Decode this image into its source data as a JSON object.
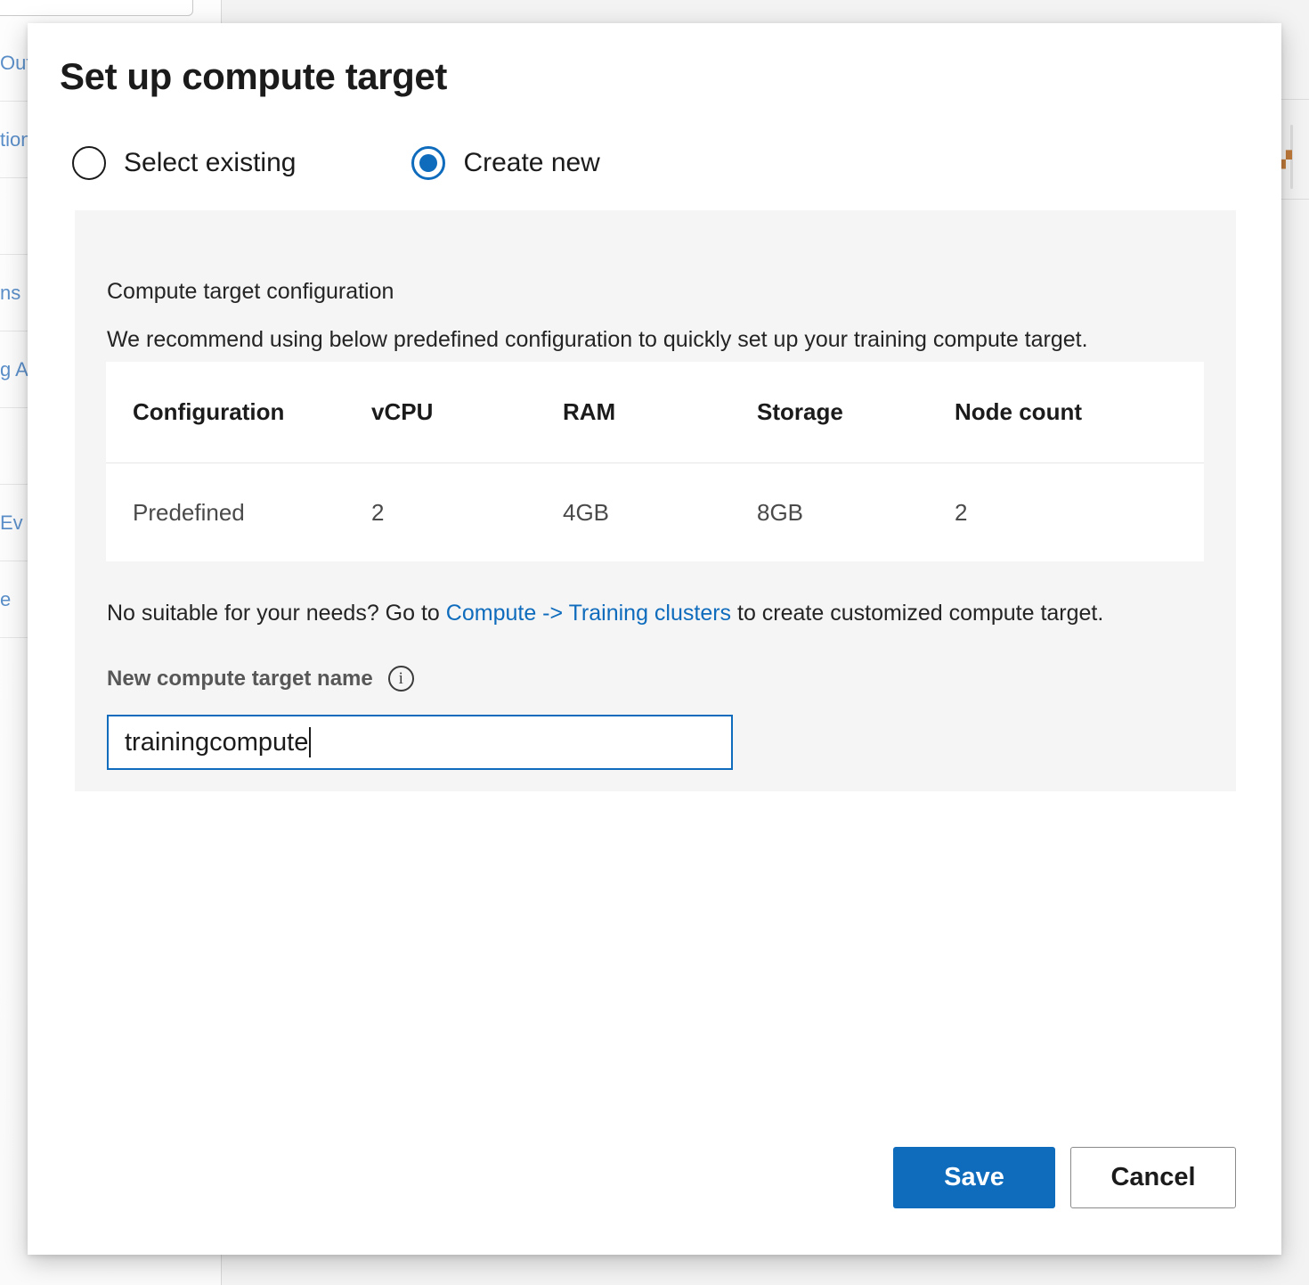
{
  "background": {
    "left_list_items": [
      {
        "label": "Out"
      },
      {
        "label": "tion"
      },
      {
        "label": ""
      },
      {
        "label": "ns"
      },
      {
        "label": "g A"
      },
      {
        "label": ""
      },
      {
        "label": "Ev"
      },
      {
        "label": "e"
      }
    ],
    "fragment_icon": "▞"
  },
  "modal": {
    "title": "Set up compute target",
    "mode_options": [
      {
        "id": "select-existing",
        "label": "Select existing",
        "selected": false
      },
      {
        "id": "create-new",
        "label": "Create new",
        "selected": true
      }
    ],
    "panel": {
      "heading": "Compute target configuration",
      "description": "We recommend using below predefined configuration to quickly set up your training compute target.",
      "table": {
        "columns": [
          "Configuration",
          "vCPU",
          "RAM",
          "Storage",
          "Node count"
        ],
        "rows": [
          [
            "Predefined",
            "2",
            "4GB",
            "8GB",
            "2"
          ]
        ]
      },
      "note": {
        "prefix": "No suitable for your needs? Go to ",
        "link": "Compute -> Training clusters",
        "suffix": " to create customized compute target."
      },
      "field": {
        "label": "New compute target name",
        "info_icon": "i",
        "value": "trainingcompute",
        "placeholder": ""
      }
    },
    "footer": {
      "save_label": "Save",
      "cancel_label": "Cancel"
    }
  },
  "colors": {
    "accent": "#0f6cbd",
    "panel_bg": "#f5f5f5",
    "text": "#1b1b1b",
    "muted_text": "#575757"
  }
}
